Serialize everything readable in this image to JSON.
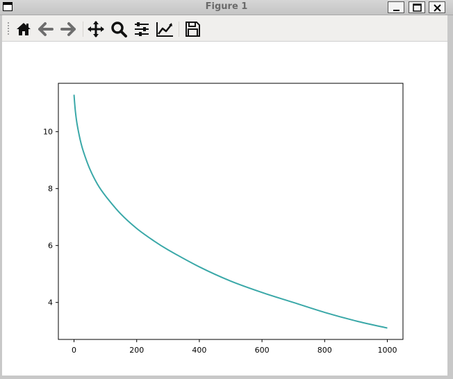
{
  "window": {
    "title": "Figure 1"
  },
  "toolbar": {
    "tools": [
      "home-icon",
      "back-arrow-icon",
      "forward-arrow-icon",
      "pan-icon",
      "zoom-icon",
      "configure-subplots-icon",
      "edit-axes-icon",
      "save-icon"
    ]
  },
  "colors": {
    "line": "#3aa8a8",
    "axes": "#000000",
    "titlebar": "#c8c8c8"
  },
  "chart_data": {
    "type": "line",
    "title": "",
    "xlabel": "",
    "ylabel": "",
    "xlim": [
      -50,
      1050
    ],
    "ylim": [
      2.7,
      11.7
    ],
    "xticks": [
      0,
      200,
      400,
      600,
      800,
      1000
    ],
    "yticks": [
      4,
      6,
      8,
      10
    ],
    "grid": false,
    "series": [
      {
        "x": [
          0,
          2,
          5,
          10,
          20,
          30,
          50,
          75,
          100,
          150,
          200,
          250,
          300,
          400,
          500,
          600,
          700,
          800,
          900,
          1000
        ],
        "y": [
          11.3,
          11.0,
          10.65,
          10.25,
          9.7,
          9.3,
          8.7,
          8.15,
          7.75,
          7.1,
          6.6,
          6.2,
          5.85,
          5.25,
          4.75,
          4.35,
          4.0,
          3.65,
          3.35,
          3.1
        ]
      }
    ]
  }
}
